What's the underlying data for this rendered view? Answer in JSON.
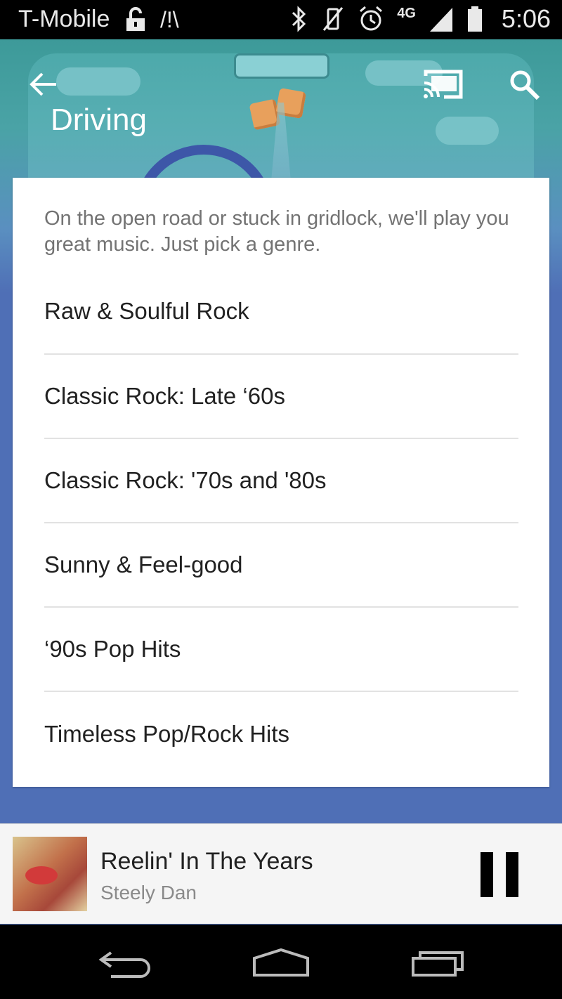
{
  "status_bar": {
    "carrier": "T-Mobile",
    "network": "4G",
    "time": "5:06"
  },
  "app_bar": {
    "title": "Driving"
  },
  "card": {
    "intro": "On the open road or stuck in gridlock, we'll play you great music. Just pick a genre.",
    "genres": [
      "Raw & Soulful Rock",
      "Classic Rock: Late ‘60s",
      "Classic Rock: '70s and '80s",
      "Sunny & Feel-good",
      "‘90s Pop Hits",
      "Timeless Pop/Rock Hits"
    ]
  },
  "now_playing": {
    "title": "Reelin' In The Years",
    "artist": "Steely Dan"
  },
  "colors": {
    "accent_background": "#4f6fb6",
    "header_teal": "#3d9a99"
  }
}
